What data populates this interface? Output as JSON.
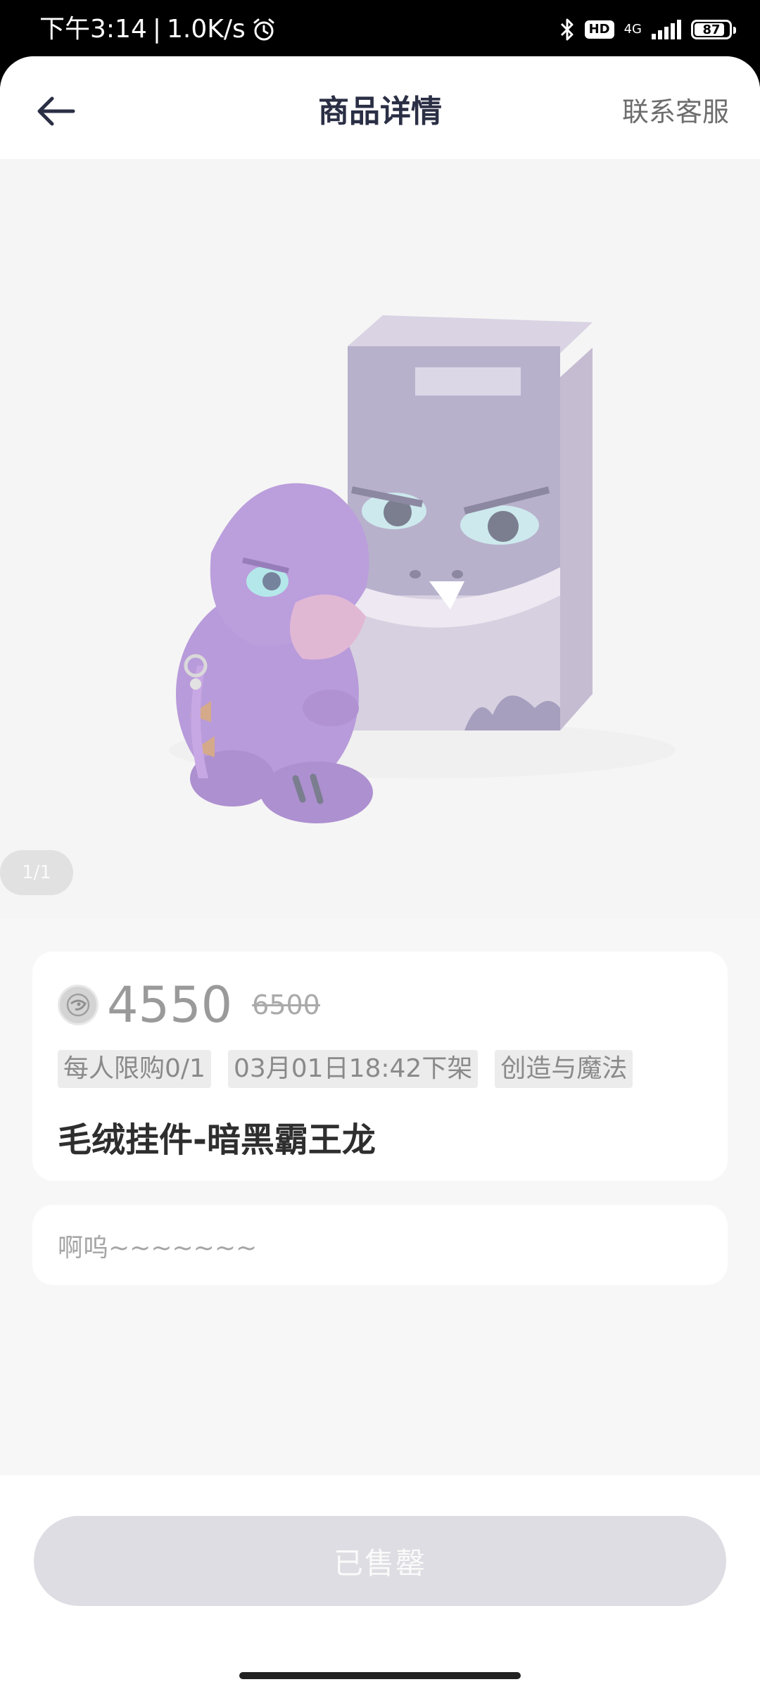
{
  "status_bar": {
    "time": "下午3:14",
    "separator": "|",
    "speed": "1.0K/s",
    "hd": "HD",
    "network": "4G",
    "battery": "87",
    "battery_level": 0.87
  },
  "header": {
    "title": "商品详情",
    "contact_label": "联系客服"
  },
  "gallery": {
    "counter": "1/1"
  },
  "product": {
    "price": "4550",
    "original_price": "6500",
    "tags": [
      "每人限购0/1",
      "03月01日18:42下架",
      "创造与魔法"
    ],
    "name": "毛绒挂件-暗黑霸王龙",
    "description": "啊呜~~~~~~~"
  },
  "bottom": {
    "button_label": "已售罄"
  }
}
